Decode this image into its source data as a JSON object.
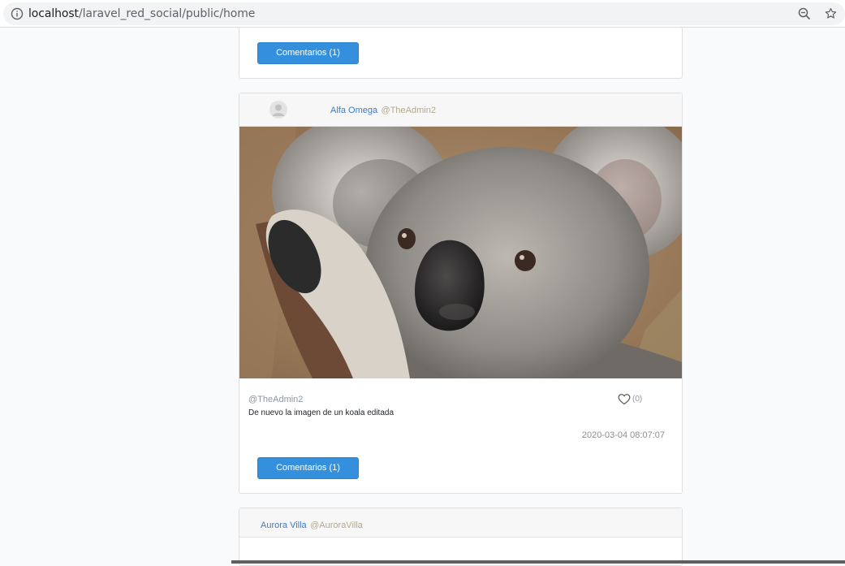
{
  "browser": {
    "url_host": "localhost",
    "url_path": "/laravel_red_social/public/home",
    "icons": [
      "info-icon",
      "zoom-out-icon",
      "star-icon"
    ]
  },
  "posts": [
    {
      "comments_button": "Comentarios (1)"
    },
    {
      "author_name": "Alfa Omega",
      "author_nick": "@TheAdmin2",
      "image_alt": "koala photo",
      "meta_nick": "@TheAdmin2",
      "description": "De nuevo la imagen de un koala editada",
      "likes": "(0)",
      "date": "2020-03-04 08:07:07",
      "comments_button": "Comentarios (1)"
    },
    {
      "author_name": "Aurora Villa",
      "author_nick": "@AuroraVilla"
    }
  ],
  "colors": {
    "button": "#3490dc",
    "link": "#3c7bc8",
    "nick": "#b3a98c",
    "page_bg": "#f8fafc"
  }
}
